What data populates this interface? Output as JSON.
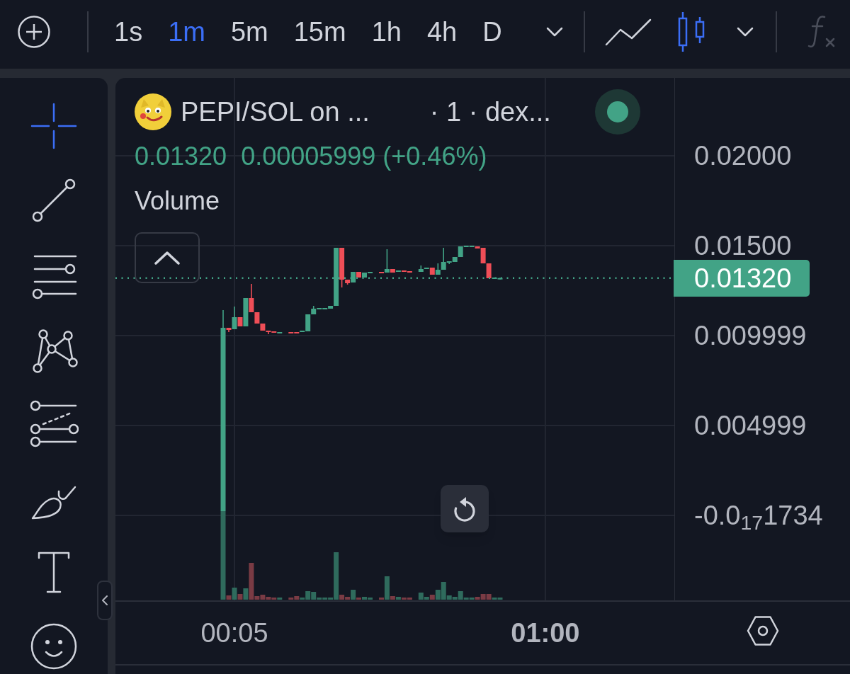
{
  "top_bar": {
    "intervals": [
      {
        "label": "1s",
        "selected": false
      },
      {
        "label": "1m",
        "selected": true
      },
      {
        "label": "5m",
        "selected": false
      },
      {
        "label": "15m",
        "selected": false
      },
      {
        "label": "1h",
        "selected": false
      },
      {
        "label": "4h",
        "selected": false
      },
      {
        "label": "D",
        "selected": false
      }
    ],
    "chart_types": [
      {
        "kind": "line",
        "selected": false
      },
      {
        "kind": "candles",
        "selected": true
      }
    ],
    "indicators": {
      "disabled": true
    }
  },
  "drawing_tools": [
    {
      "kind": "crosshair",
      "selected": true
    },
    {
      "kind": "trend_line",
      "selected": false
    },
    {
      "kind": "horizontal_lines",
      "selected": false
    },
    {
      "kind": "pattern",
      "selected": false
    },
    {
      "kind": "projection",
      "selected": false
    },
    {
      "kind": "brush",
      "selected": false
    },
    {
      "kind": "text",
      "selected": false
    },
    {
      "kind": "emoji",
      "selected": false
    }
  ],
  "chart": {
    "legend": {
      "symbol": "PEPI/SOL on ...",
      "details": "· 1 · dex...",
      "price": "0.01320",
      "change": "0.00005999 (+0.46%)",
      "rising": true,
      "indicator": "Volume"
    },
    "last_price": "0.01320",
    "time_axis": {
      "bold": [
        false,
        true
      ]
    },
    "chart_data": {
      "type": "candlestick",
      "x": [
        3,
        4,
        5,
        6,
        7,
        8,
        9,
        10,
        11,
        12,
        13,
        15,
        16,
        17,
        18,
        19,
        20,
        21,
        22,
        23,
        24,
        25,
        26,
        27,
        28,
        29,
        31,
        32,
        33,
        34,
        35,
        36,
        38,
        39,
        40,
        41,
        42,
        43,
        44,
        45,
        46,
        47,
        48,
        49,
        50,
        51,
        52
      ],
      "ohlc": [
        [
          0.000236,
          0.011417,
          0.000236,
          0.010433
        ],
        [
          0.010433,
          0.010433,
          0.010197,
          0.010315
        ],
        [
          0.010354,
          0.011614,
          0.010354,
          0.011024
        ],
        [
          0.011024,
          0.011024,
          0.010512,
          0.010512
        ],
        [
          0.010512,
          0.012087,
          0.010512,
          0.012087
        ],
        [
          0.012087,
          0.012874,
          0.011299,
          0.011299
        ],
        [
          0.011299,
          0.011299,
          0.010669,
          0.010669
        ],
        [
          0.010669,
          0.010669,
          0.010276,
          0.010276
        ],
        [
          0.010276,
          0.010276,
          0.010079,
          0.010197
        ],
        [
          0.010236,
          0.010236,
          0.010157,
          0.010157
        ],
        [
          0.010118,
          0.010197,
          0.010118,
          0.010197
        ],
        [
          0.010197,
          0.010197,
          0.010118,
          0.010118
        ],
        [
          0.010197,
          0.010197,
          0.010118,
          0.010118
        ],
        [
          0.010197,
          0.010276,
          0.010197,
          0.010276
        ],
        [
          0.010236,
          0.011181,
          0.010236,
          0.011181
        ],
        [
          0.011181,
          0.011654,
          0.011181,
          0.011496
        ],
        [
          0.011457,
          0.011535,
          0.011457,
          0.011535
        ],
        [
          0.011457,
          0.011535,
          0.011457,
          0.011535
        ],
        [
          0.011496,
          0.011654,
          0.011496,
          0.011654
        ],
        [
          0.011654,
          0.014882,
          0.011654,
          0.014882
        ],
        [
          0.014882,
          0.014882,
          0.012677,
          0.01311
        ],
        [
          0.01311,
          0.01311,
          0.012835,
          0.012913
        ],
        [
          0.012953,
          0.013543,
          0.012953,
          0.013543
        ],
        [
          0.013543,
          0.013543,
          0.013228,
          0.013228
        ],
        [
          0.013228,
          0.013504,
          0.013228,
          0.013504
        ],
        [
          0.013465,
          0.013543,
          0.013465,
          0.013543
        ],
        [
          0.013543,
          0.013543,
          0.013465,
          0.013465
        ],
        [
          0.013504,
          0.014803,
          0.013504,
          0.013701
        ],
        [
          0.013701,
          0.013701,
          0.013504,
          0.013504
        ],
        [
          0.013543,
          0.013622,
          0.013543,
          0.013622
        ],
        [
          0.013622,
          0.013622,
          0.013543,
          0.013543
        ],
        [
          0.013583,
          0.013583,
          0.013504,
          0.013504
        ],
        [
          0.013543,
          0.013898,
          0.013543,
          0.013701
        ],
        [
          0.013701,
          0.01378,
          0.013701,
          0.01378
        ],
        [
          0.01378,
          0.01378,
          0.013386,
          0.013386
        ],
        [
          0.013386,
          0.014016,
          0.013386,
          0.013661
        ],
        [
          0.013661,
          0.014882,
          0.013661,
          0.014094
        ],
        [
          0.014055,
          0.014134,
          0.013976,
          0.014134
        ],
        [
          0.014094,
          0.01437,
          0.014094,
          0.01437
        ],
        [
          0.01437,
          0.014961,
          0.01437,
          0.014961
        ],
        [
          0.014921,
          0.015,
          0.014921,
          0.015
        ],
        [
          0.014921,
          0.015,
          0.014921,
          0.015
        ],
        [
          0.014961,
          0.014961,
          0.014843,
          0.014843
        ],
        [
          0.014882,
          0.014882,
          0.014016,
          0.014016
        ],
        [
          0.014016,
          0.014016,
          0.013189,
          0.013189
        ],
        [
          0.01315,
          0.013228,
          0.01315,
          0.013228
        ],
        [
          0.01315,
          0.01322,
          0.01315,
          0.0132
        ]
      ],
      "xlim": [
        -16.05,
        113.9
      ],
      "ylim": [
        -0.008346,
        0.024331
      ],
      "grid": true,
      "xticks": [
        {
          "value": 5,
          "label": "00:05"
        },
        {
          "value": 60,
          "label": "01:00"
        }
      ],
      "yticks": [
        {
          "value": 0.02,
          "label": "0.02000"
        },
        {
          "value": 0.015,
          "label": "0.01500"
        },
        {
          "value": 0.009999,
          "label": "0.009999"
        },
        {
          "value": 0.004999,
          "label": "0.004999"
        },
        {
          "value": -1.734e-18,
          "label": "-0.0$_{17}$1734"
        }
      ]
    }
  }
}
